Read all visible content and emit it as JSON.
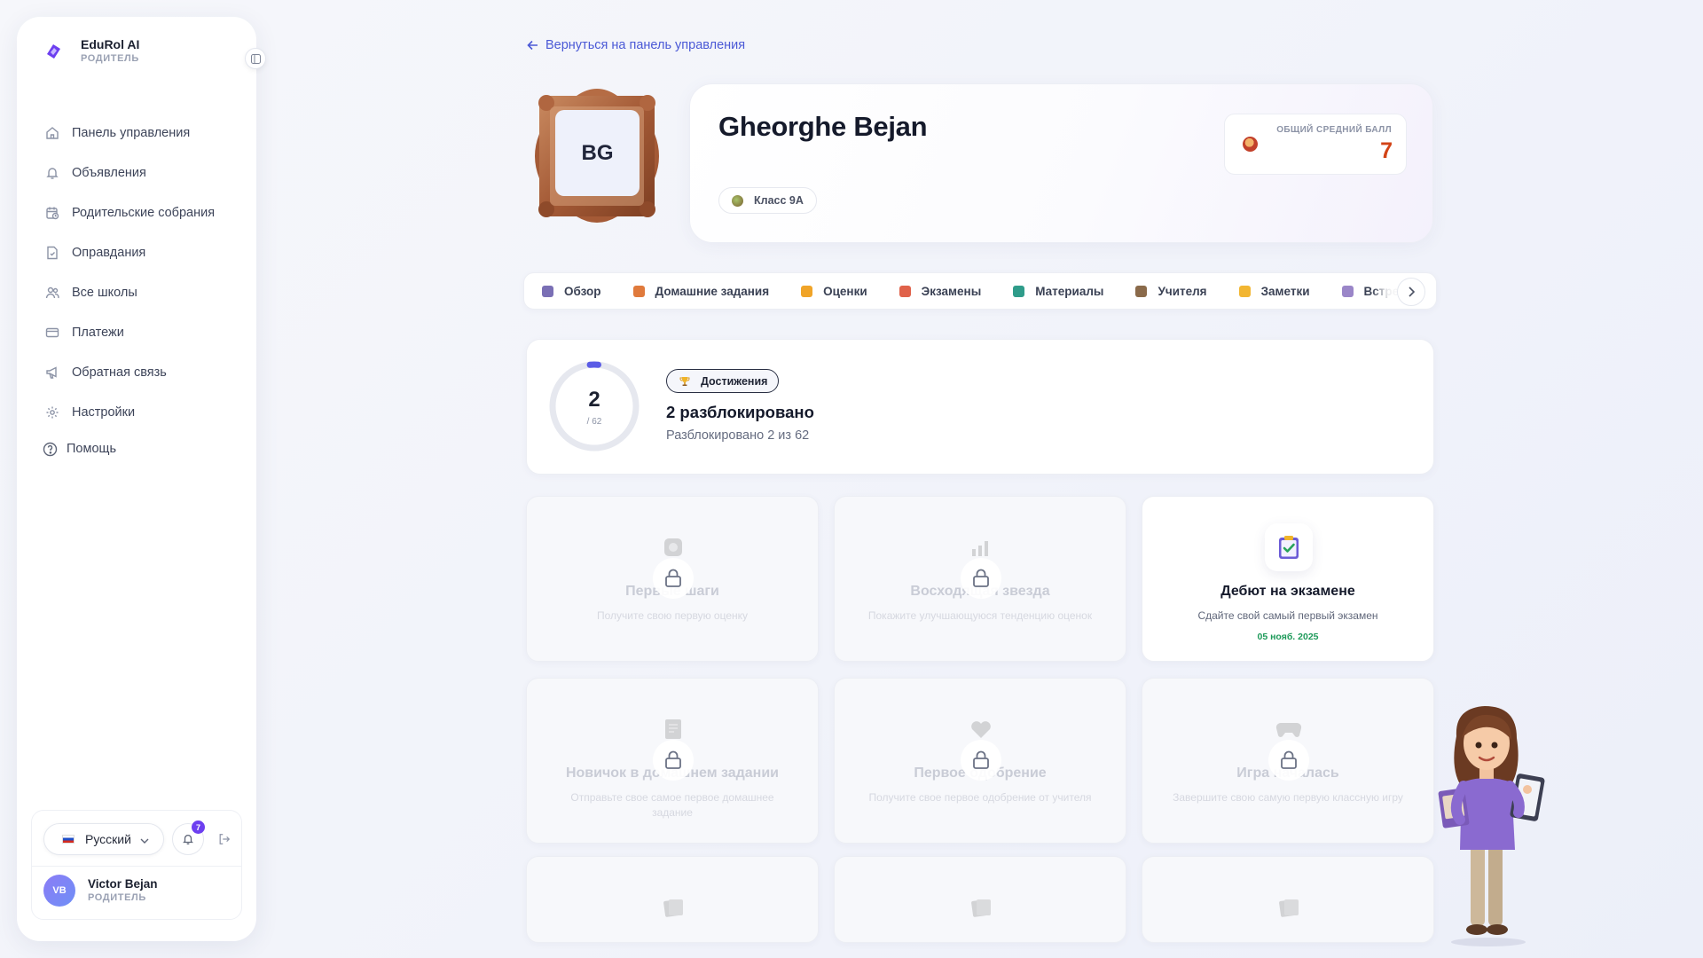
{
  "brand": {
    "name": "EduRol AI",
    "role": "РОДИТЕЛЬ"
  },
  "sidebar": {
    "items": [
      {
        "label": "Панель управления",
        "icon": "home-icon"
      },
      {
        "label": "Объявления",
        "icon": "bell-icon"
      },
      {
        "label": "Родительские собрания",
        "icon": "calendar-clock-icon"
      },
      {
        "label": "Оправдания",
        "icon": "document-check-icon"
      },
      {
        "label": "Все школы",
        "icon": "users-icon"
      },
      {
        "label": "Платежи",
        "icon": "credit-card-icon"
      },
      {
        "label": "Обратная связь",
        "icon": "megaphone-icon"
      },
      {
        "label": "Настройки",
        "icon": "gear-icon"
      }
    ],
    "help_label": "Помощь",
    "language": "Русский",
    "notification_count": "7",
    "user": {
      "initials": "VB",
      "name": "Victor Bejan",
      "role": "РОДИТЕЛЬ"
    }
  },
  "main": {
    "back_link": "Вернуться на панель управления",
    "student": {
      "initials": "BG",
      "name": "Gheorghe Bejan",
      "class_label": "Класс 9A",
      "gpa_label": "ОБЩИЙ СРЕДНИЙ БАЛЛ",
      "gpa_value": "7"
    },
    "tabs": [
      {
        "label": "Обзор",
        "color": "#7a6fb5"
      },
      {
        "label": "Домашние задания",
        "color": "#e07a3c"
      },
      {
        "label": "Оценки",
        "color": "#f0a428"
      },
      {
        "label": "Экзамены",
        "color": "#e0624a"
      },
      {
        "label": "Материалы",
        "color": "#2f9c8a"
      },
      {
        "label": "Учителя",
        "color": "#8a6a4a"
      },
      {
        "label": "Заметки",
        "color": "#f2b632"
      },
      {
        "label": "Встречи",
        "color": "#9a86c8"
      }
    ],
    "summary": {
      "unlocked": "2",
      "total": "/ 62",
      "progress_fraction": 0.032,
      "chip_label": "Достижения",
      "title": "2 разблокировано",
      "subtitle": "Разблокировано 2 из 62"
    },
    "achievements": [
      {
        "title": "Первые шаги",
        "desc": "Получите свою первую оценку",
        "locked": true,
        "icon": "badge-icon"
      },
      {
        "title": "Восходящая звезда",
        "desc": "Покажите улучшающуюся тенденцию оценок",
        "locked": true,
        "icon": "chart-up-icon"
      },
      {
        "title": "Дебют на экзамене",
        "desc": "Сдайте свой самый первый экзамен",
        "locked": false,
        "date": "05 нояб. 2025",
        "icon": "clipboard-check-icon"
      },
      {
        "title": "Новичок в домашнем задании",
        "desc": "Отправьте свое самое первое домашнее задание",
        "locked": true,
        "icon": "notebook-icon"
      },
      {
        "title": "Первое одобрение",
        "desc": "Получите свое первое одобрение от учителя",
        "locked": true,
        "icon": "heart-icon"
      },
      {
        "title": "Игра началась",
        "desc": "Завершите свою самую первую классную игру",
        "locked": true,
        "icon": "gamepad-icon"
      }
    ]
  },
  "colors": {
    "accent": "#4b59d6",
    "gpa": "#d24316",
    "date": "#1e9a5a",
    "ring": "#5b5ce6"
  }
}
